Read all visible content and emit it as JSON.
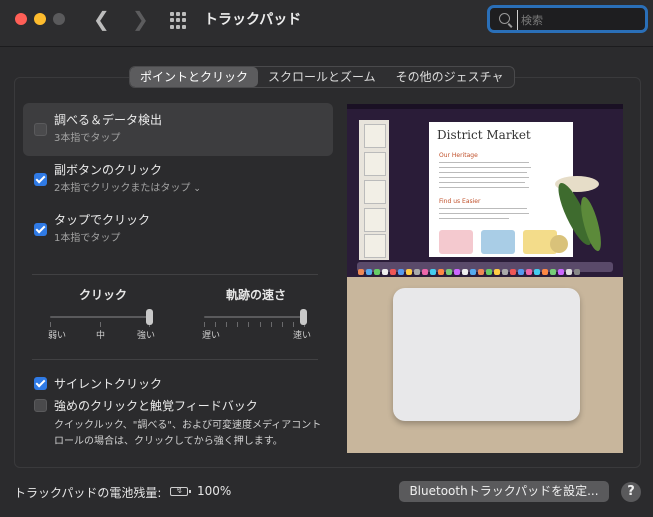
{
  "window": {
    "title": "トラックパッド"
  },
  "search": {
    "placeholder": "検索"
  },
  "tabs": [
    {
      "label": "ポイントとクリック",
      "active": true
    },
    {
      "label": "スクロールとズーム",
      "active": false
    },
    {
      "label": "その他のジェスチャ",
      "active": false
    }
  ],
  "options": {
    "lookup": {
      "title": "調べる＆データ検出",
      "subtitle": "3本指でタップ",
      "checked": false
    },
    "secondary": {
      "title": "副ボタンのクリック",
      "subtitle": "2本指でクリックまたはタップ",
      "checked": true
    },
    "tap": {
      "title": "タップでクリック",
      "subtitle": "1本指でタップ",
      "checked": true
    },
    "silent": {
      "title": "サイレントクリック",
      "checked": true
    },
    "force": {
      "title": "強めのクリックと触覚フィードバック",
      "checked": false,
      "description": "クイックルック、\"調べる\"、および可変速度メディアコントロールの場合は、クリックしてから強く押します。"
    }
  },
  "sliders": {
    "click": {
      "title": "クリック",
      "labels": [
        "弱い",
        "中",
        "強い"
      ],
      "level": 1.0
    },
    "tracking": {
      "title": "軌跡の速さ",
      "labels": [
        "遅い",
        "速い"
      ],
      "level": 1.0
    }
  },
  "preview": {
    "doc_title": "District Market",
    "heading1": "Our Heritage",
    "heading2": "Find us Easier"
  },
  "footer": {
    "battery_label": "トラックパッドの電池残量:",
    "battery_value": "100%",
    "bluetooth_button": "Bluetoothトラックパッドを設定...",
    "help": "?"
  },
  "colors": {
    "accent": "#2f7ae5",
    "search_focus": "#2a6fb8"
  }
}
